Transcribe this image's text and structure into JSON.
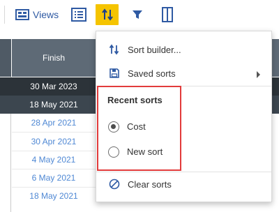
{
  "toolbar": {
    "views_label": "Views",
    "icons": [
      "views-icon",
      "list-icon",
      "sort-icon",
      "filter-icon",
      "column-icon"
    ],
    "sort_active_color": "#f5c400"
  },
  "grid": {
    "column_header": "Finish",
    "rows": [
      "30 Mar 2023",
      "18 May 2021",
      "28 Apr 2021",
      "30 Apr 2021",
      "4 May 2021",
      "6 May 2021",
      "18 May 2021"
    ]
  },
  "sort_menu": {
    "sort_builder": "Sort builder...",
    "saved_sorts": "Saved sorts",
    "recent_title": "Recent sorts",
    "recent_sorts": [
      {
        "label": "Cost",
        "selected": true
      },
      {
        "label": "New sort",
        "selected": false
      }
    ],
    "clear_sorts": "Clear sorts",
    "highlight_color": "#e23b3b"
  }
}
